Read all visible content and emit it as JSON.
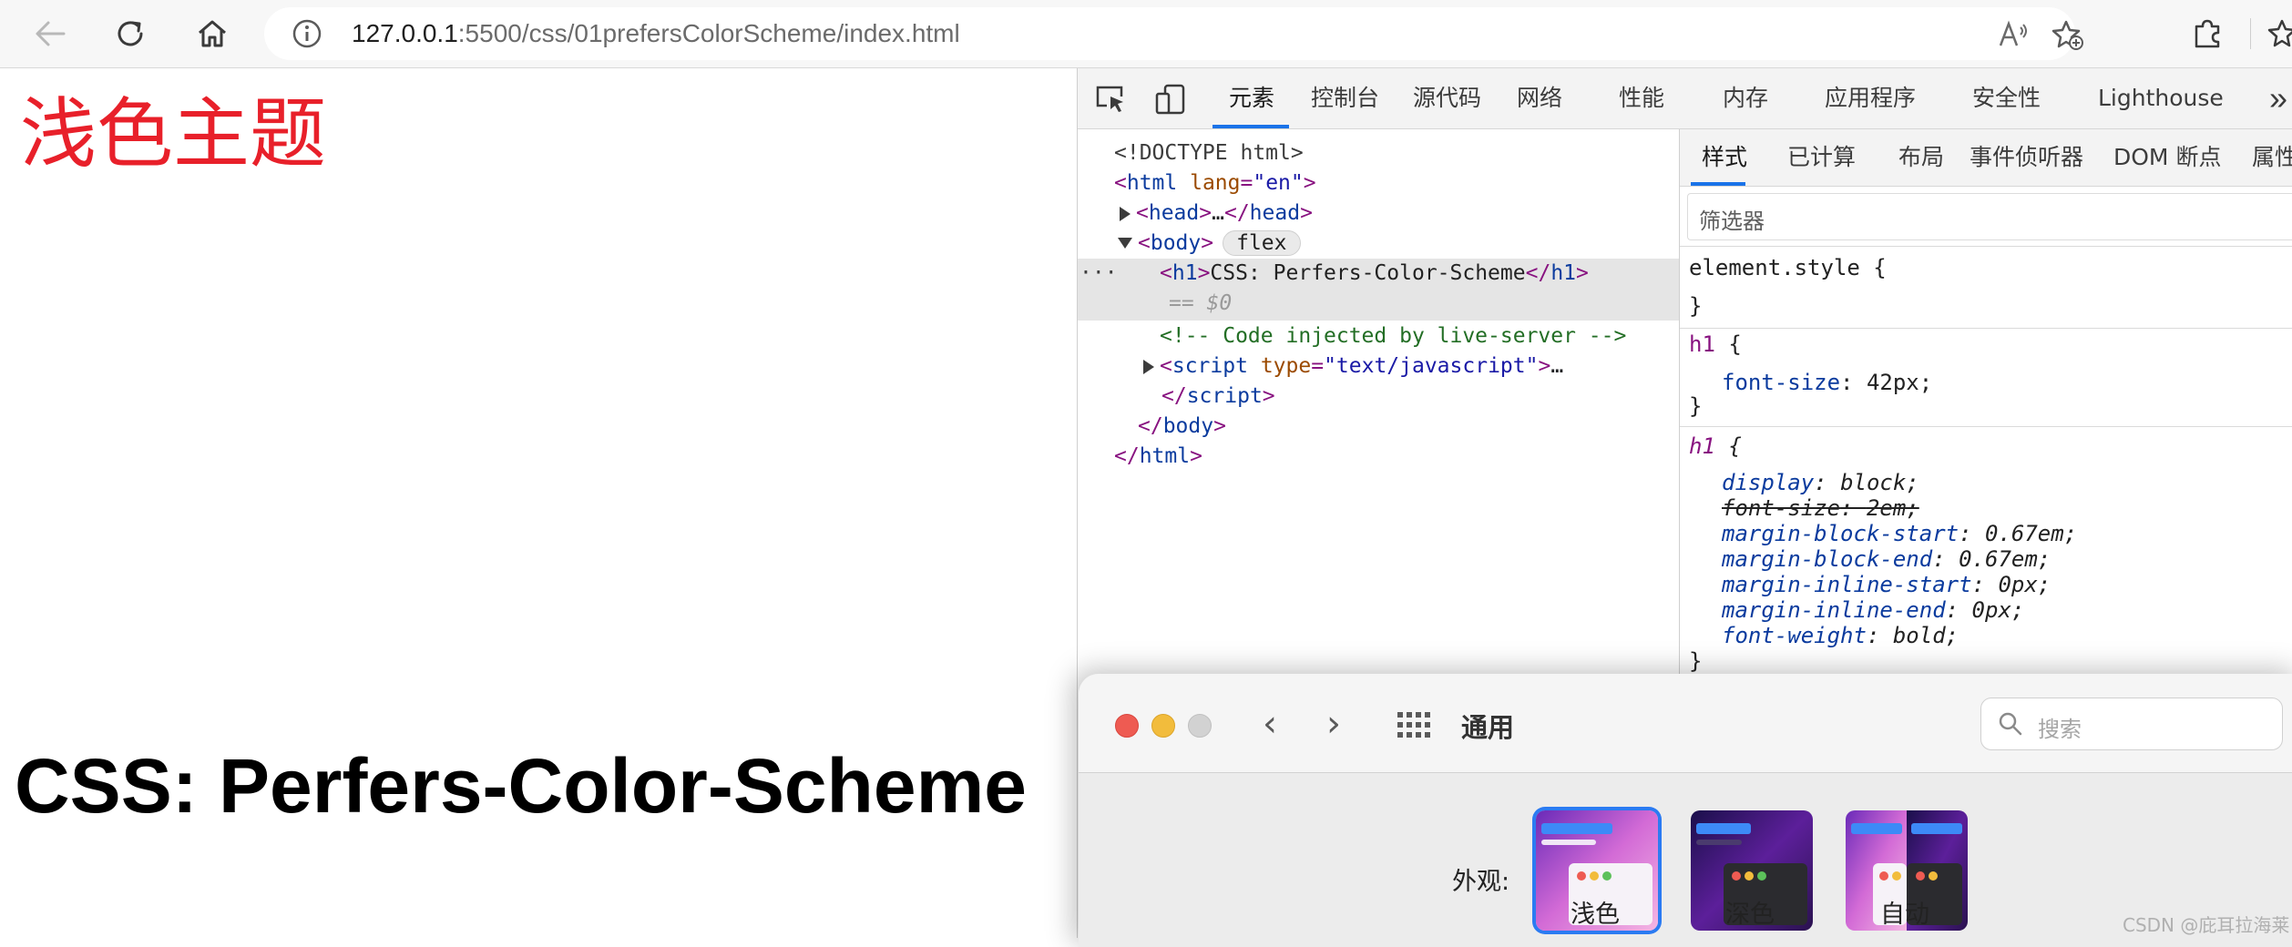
{
  "browser": {
    "address": {
      "host": "127.0.0.1",
      "path": ":5500/css/01prefersColorScheme/index.html"
    }
  },
  "page": {
    "theme_heading": "浅色主题",
    "h1": "CSS: Perfers-Color-Scheme"
  },
  "devtools": {
    "tabs": [
      "元素",
      "控制台",
      "源代码",
      "网络",
      "性能",
      "内存",
      "应用程序",
      "安全性",
      "Lighthouse"
    ],
    "active_tab": "元素",
    "dom": {
      "doctype": "<!DOCTYPE html>",
      "html_open_tag": "html",
      "html_attr": "lang",
      "html_attr_val": "\"en\"",
      "head": "head",
      "head_ellipsis": "…",
      "body": "body",
      "body_badge": "flex",
      "h1_tag": "h1",
      "h1_text": "CSS: Perfers-Color-Scheme",
      "selected_marker": "== $0",
      "dots": "···",
      "comment": "<!-- Code injected by live-server -->",
      "script": "script",
      "script_attr": "type",
      "script_attr_val": "\"text/javascript\"",
      "script_ellipsis": "…"
    },
    "styles_tabs": [
      "样式",
      "已计算",
      "布局",
      "事件侦听器",
      "DOM 断点",
      "属性"
    ],
    "filter_placeholder": "筛选器",
    "rules": {
      "element_style": "element.style {",
      "close": "}",
      "rule1_selector": "h1",
      "rule1_props": [
        {
          "name": "font-size",
          "value": "42px;"
        }
      ],
      "rule2_selector": "h1",
      "rule2_props": [
        {
          "name": "display",
          "value": "block;"
        },
        {
          "name": "font-size",
          "value": "2em;"
        },
        {
          "name": "margin-block-start",
          "value": "0.67em;"
        },
        {
          "name": "margin-block-end",
          "value": "0.67em;"
        },
        {
          "name": "margin-inline-start",
          "value": "0px;"
        },
        {
          "name": "margin-inline-end",
          "value": "0px;"
        },
        {
          "name": "font-weight",
          "value": "bold;"
        }
      ]
    }
  },
  "prefs": {
    "title": "通用",
    "search_placeholder": "搜索",
    "appearance_label": "外观:",
    "options": [
      "浅色",
      "深色",
      "自动"
    ],
    "selected_option": "浅色"
  },
  "watermark": "CSDN @庇耳拉海莱",
  "colors": {
    "heading_red": "#e8202a",
    "accent_blue": "#1a73e8",
    "selection_blue": "#2b7bf2"
  }
}
